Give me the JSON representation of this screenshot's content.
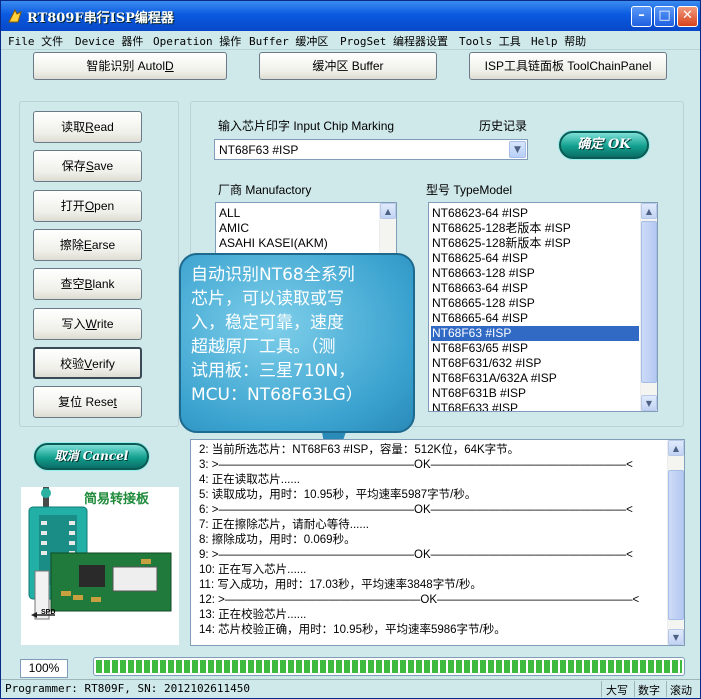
{
  "window": {
    "title": "RT809F串行ISP编程器",
    "min_glyph": "–",
    "max_glyph": "□",
    "close_glyph": "✕"
  },
  "menu": [
    "File 文件",
    "Device 器件",
    "Operation 操作",
    "Buffer 缓冲区",
    "ProgSet 编程器设置",
    "Tools 工具",
    "Help 帮助"
  ],
  "toolbar": {
    "autoid": {
      "text": "智能识别 Autol",
      "mnemonic": "D"
    },
    "buffer": "缓冲区 Buffer",
    "toolchain": "ISP工具链面板  ToolChainPanel"
  },
  "ops": [
    {
      "text": "读取 ",
      "mnemonic": "R",
      "rest": "ead"
    },
    {
      "text": "保存 ",
      "mnemonic": "S",
      "rest": "ave"
    },
    {
      "text": "打开 ",
      "mnemonic": "O",
      "rest": "pen"
    },
    {
      "text": "擦除 ",
      "mnemonic": "E",
      "rest": "arse"
    },
    {
      "text": "查空 ",
      "mnemonic": "B",
      "rest": "lank"
    },
    {
      "text": "写入 ",
      "mnemonic": "W",
      "rest": "rite"
    },
    {
      "text": "校验 ",
      "mnemonic": "V",
      "rest": "erify"
    },
    {
      "text": "复位 Rese",
      "mnemonic": "t",
      "rest": ""
    }
  ],
  "chip": {
    "marking_label": "输入芯片印字 Input Chip Marking",
    "history_label": "历史记录",
    "marking_value": "NT68F63 #ISP",
    "ok_label": "确定 OK",
    "manufactory_label": "厂商 Manufactory",
    "typemodel_label": "型号 TypeModel"
  },
  "manufacturers": [
    "ALL",
    "AMIC",
    "ASAHI KASEI(AKM)"
  ],
  "type_models": [
    "NT68623-64 #ISP",
    "NT68625-128老版本 #ISP",
    "NT68625-128新版本 #ISP",
    "NT68625-64 #ISP",
    "NT68663-128 #ISP",
    "NT68663-64 #ISP",
    "NT68665-128 #ISP",
    "NT68665-64 #ISP",
    "NT68F63 #ISP",
    "NT68F63/65 #ISP",
    "NT68F631/632 #ISP",
    "NT68F631A/632A #ISP",
    "NT68F631B #ISP",
    "NT68F633 #ISP"
  ],
  "selected_type_model": "NT68F63 #ISP",
  "callout": {
    "lines": [
      "自动识别NT68全系列",
      "芯片，可以读取或写",
      "入，稳定可靠，速度",
      "超越原厂工具。（测",
      "试用板：三星710N，",
      "MCU：NT68F63LG）"
    ]
  },
  "cancel_label": "取消 Cancel",
  "adapter": {
    "title": "简易转接板",
    "arrow_label": "SPD"
  },
  "log": [
    "2:  当前所选芯片：NT68F63 #ISP，容量：512K位，64K字节。",
    "3:  >—————————————————OK—————————————————<",
    "4:  正在读取芯片......",
    "5:  读取成功，用时：10.95秒，平均速率5987字节/秒。",
    "6:  >—————————————————OK—————————————————<",
    "7:  正在擦除芯片，请耐心等待......",
    "8:  擦除成功，用时：0.069秒。",
    "9:  >—————————————————OK—————————————————<",
    "10:  正在写入芯片......",
    "11:  写入成功，用时：17.03秒，平均速率3848字节/秒。",
    "12:  >—————————————————OK—————————————————<",
    "13:  正在校验芯片......",
    "14:  芯片校验正确，用时：10.95秒，平均速率5986字节/秒。"
  ],
  "progress": {
    "label": "100%",
    "value": 100
  },
  "status": {
    "programmer": "Programmer: RT809F, SN: 2012102611450",
    "caps": "大写",
    "num": "数字",
    "scroll": "滚动"
  }
}
